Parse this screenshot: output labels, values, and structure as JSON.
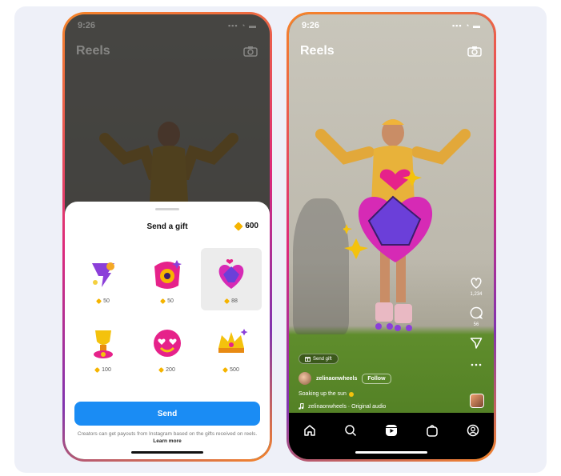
{
  "colors": {
    "accent": "#1a8cf4",
    "coin": "#f5b400",
    "frame_gradient": [
      "#f58529",
      "#dd2a7b",
      "#8134af"
    ]
  },
  "phone_left": {
    "statusbar": {
      "time": "9:26",
      "icons": "▪▪▪ ◔ ▬"
    },
    "header": {
      "title": "Reels",
      "camera_icon": "camera-icon"
    },
    "gift_sheet": {
      "title": "Send a gift",
      "coin_balance": "600",
      "gifts": [
        {
          "name": "tornado-gift-icon",
          "price": "50",
          "selected": false
        },
        {
          "name": "burst-gift-icon",
          "price": "50",
          "selected": false
        },
        {
          "name": "heart-hands-gift-icon",
          "price": "88",
          "selected": true
        },
        {
          "name": "trophy-gift-icon",
          "price": "100",
          "selected": false
        },
        {
          "name": "heart-eyes-gift-icon",
          "price": "200",
          "selected": false
        },
        {
          "name": "crown-gift-icon",
          "price": "500",
          "selected": false
        }
      ],
      "send_label": "Send",
      "disclaimer": "Creators can get payouts from Instagram based on the gifts received on reels.",
      "learn_more": "Learn more"
    }
  },
  "phone_right": {
    "statusbar": {
      "time": "9:26",
      "icons": "▪▪▪ ◔ ▬"
    },
    "header": {
      "title": "Reels",
      "camera_icon": "camera-icon"
    },
    "side_actions": [
      {
        "icon": "heart-icon",
        "count": "1,234"
      },
      {
        "icon": "comment-icon",
        "count": "56"
      },
      {
        "icon": "share-icon",
        "count": ""
      },
      {
        "icon": "more-icon",
        "count": ""
      }
    ],
    "send_gift_pill": "Send gift",
    "author": {
      "username": "zelinaonwheels",
      "follow_label": "Follow"
    },
    "caption": "Soaking up the sun",
    "audio": "zelinaonwheels · Original audio",
    "bottom_nav": [
      "home-icon",
      "search-icon",
      "reels-icon",
      "shop-icon",
      "profile-icon"
    ]
  }
}
